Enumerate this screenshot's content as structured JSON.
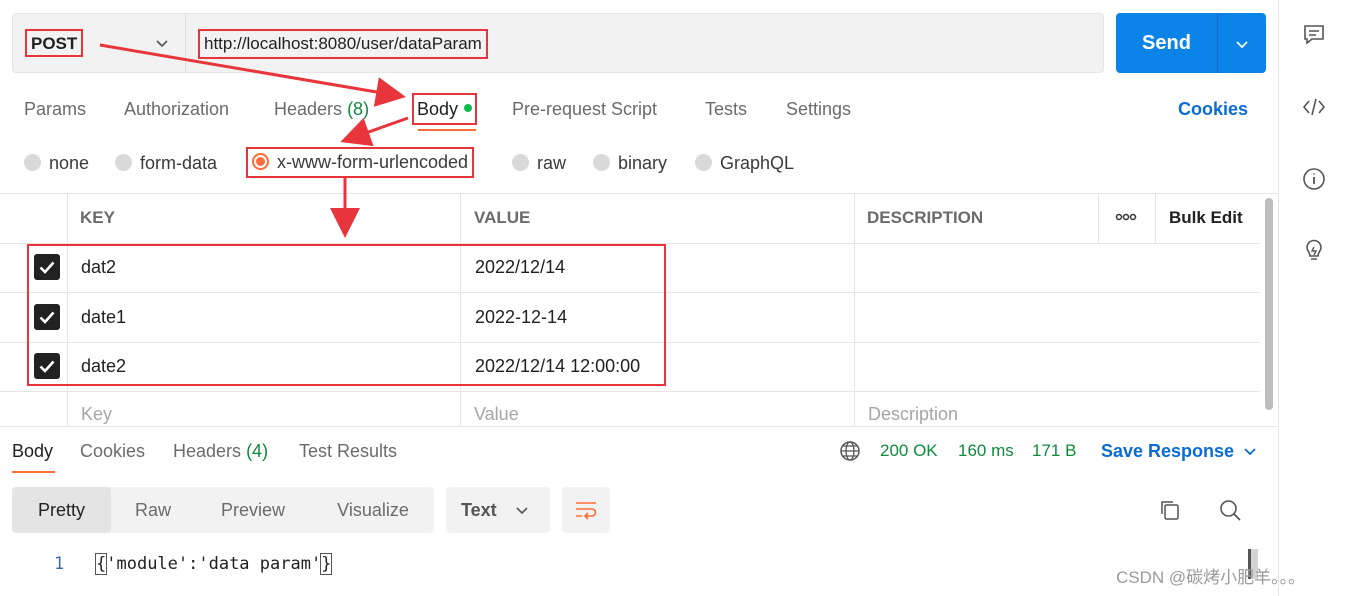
{
  "request": {
    "method": "POST",
    "url": "http://localhost:8080/user/dataParam",
    "send_label": "Send"
  },
  "tabs": {
    "params": "Params",
    "authorization": "Authorization",
    "headers": "Headers",
    "headers_count": "(8)",
    "body": "Body",
    "pre_request": "Pre-request Script",
    "tests": "Tests",
    "settings": "Settings",
    "cookies": "Cookies"
  },
  "body_types": {
    "none": "none",
    "form_data": "form-data",
    "urlencoded": "x-www-form-urlencoded",
    "raw": "raw",
    "binary": "binary",
    "graphql": "GraphQL",
    "selected": "x-www-form-urlencoded"
  },
  "table": {
    "headers": {
      "key": "KEY",
      "value": "VALUE",
      "description": "DESCRIPTION",
      "bulk_edit": "Bulk Edit"
    },
    "rows": [
      {
        "checked": true,
        "key": "dat2",
        "value": "2022/12/14",
        "description": ""
      },
      {
        "checked": true,
        "key": "date1",
        "value": "2022-12-14",
        "description": ""
      },
      {
        "checked": true,
        "key": "date2",
        "value": "2022/12/14 12:00:00",
        "description": ""
      }
    ],
    "placeholders": {
      "key": "Key",
      "value": "Value",
      "description": "Description"
    }
  },
  "response": {
    "tabs": {
      "body": "Body",
      "cookies": "Cookies",
      "headers": "Headers",
      "headers_count": "(4)",
      "test_results": "Test Results"
    },
    "status": "200 OK",
    "time": "160 ms",
    "size": "171 B",
    "save_label": "Save Response",
    "views": {
      "pretty": "Pretty",
      "raw": "Raw",
      "preview": "Preview",
      "visualize": "Visualize"
    },
    "format": "Text",
    "line_number": "1",
    "code_open": "{",
    "code_text": "'module':'data param'",
    "code_close": "}"
  },
  "watermark": "CSDN @碳烤小肥羊。。。",
  "colors": {
    "accent": "#ff6c37",
    "send": "#0a84e8",
    "link": "#0a6cd6",
    "success": "#0e8a3d",
    "annotation": "#e8353c"
  }
}
